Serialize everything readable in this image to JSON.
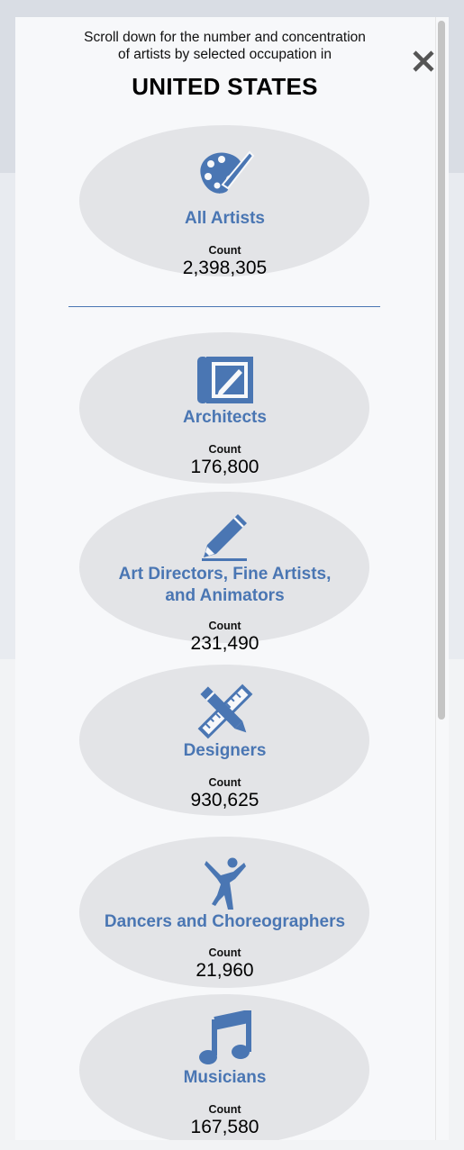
{
  "modal": {
    "intro_line1": "Scroll down for the number and concentration",
    "intro_line2": "of artists by selected occupation in",
    "country": "UNITED STATES",
    "close_label": "✕",
    "count_label": "Count"
  },
  "occupations": [
    {
      "name": "All Artists",
      "count": "2,398,305",
      "icon": "palette-icon"
    },
    {
      "name": "Architects",
      "count": "176,800",
      "icon": "drafting-board-icon"
    },
    {
      "name_line1": "Art Directors, Fine Artists,",
      "name_line2": "and Animators",
      "count": "231,490",
      "icon": "pencil-icon"
    },
    {
      "name": "Designers",
      "count": "930,625",
      "icon": "ruler-pencil-icon"
    },
    {
      "name": "Dancers and Choreographers",
      "count": "21,960",
      "icon": "dancer-icon"
    },
    {
      "name": "Musicians",
      "count": "167,580",
      "icon": "music-note-icon"
    }
  ],
  "colors": {
    "accent": "#4a76b3",
    "oval": "#e3e4e7",
    "overlay": "#8a8a8a"
  }
}
